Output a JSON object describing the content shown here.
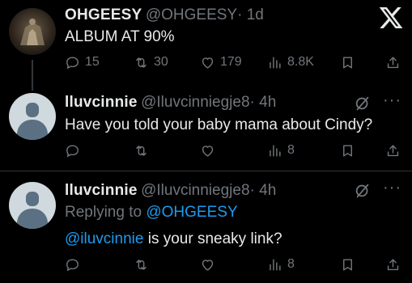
{
  "tweets": [
    {
      "name": "OHGEESY",
      "handle": "@OHGEESY",
      "time": "· 1d",
      "text": "ALBUM AT 90%",
      "replies": "15",
      "retweets": "30",
      "likes": "179",
      "views": "8.8K"
    },
    {
      "name": "lluvcinnie",
      "handle": "@Iluvcinniegje8",
      "time": "· 4h",
      "text": "Have you told your baby mama about Cindy?",
      "views": "8"
    },
    {
      "name": "lluvcinnie",
      "handle": "@Iluvcinniegje8",
      "time": "· 4h",
      "replying_prefix": "Replying to",
      "replying_to": "@OHGEESY",
      "mention": "@iluvcinnie",
      "text": " is your sneaky link?",
      "views": "8"
    }
  ],
  "icons": {
    "logo": "x-logo-icon",
    "reply": "reply-icon",
    "retweet": "retweet-icon",
    "like": "heart-icon",
    "views": "views-icon",
    "bookmark": "bookmark-icon",
    "share": "share-icon",
    "grok": "grok-icon",
    "more": "more-icon"
  },
  "colors": {
    "background": "#000000",
    "text": "#e7e9ea",
    "muted": "#71767b",
    "accent": "#1d9bf0"
  }
}
